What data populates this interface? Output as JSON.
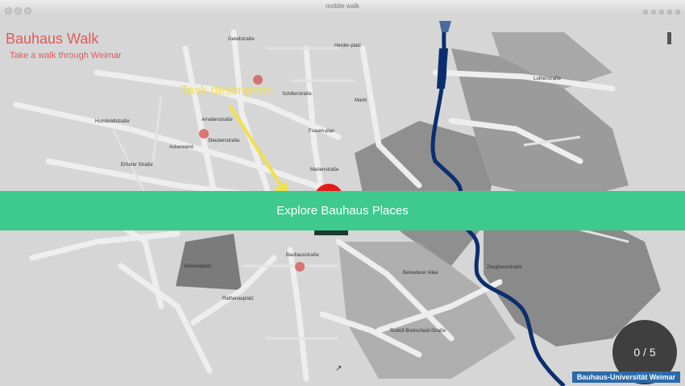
{
  "window": {
    "title": "mobile walk"
  },
  "app": {
    "title": "Bauhaus Walk",
    "subtitle": "Take a walk through Weimar"
  },
  "annotation": {
    "label": "Task description"
  },
  "task": {
    "banner_text": "Explore Bauhaus Places"
  },
  "progress": {
    "text": "0 / 5"
  },
  "footer": {
    "logo_text": "Bauhaus-Universität Weimar"
  },
  "map": {
    "street_labels": [
      "Herder-platz",
      "Lutherstraße",
      "Schillerstraße",
      "Markt",
      "Frauen-plan",
      "Steubenstraße",
      "Erfurter Straße",
      "Geleitstraße",
      "Marienstraße",
      "Bauhausstraße",
      "Belvederer Allee",
      "Rudolf-Breitscheid-Straße",
      "Wielandplatz",
      "Ackerwand",
      "Humboldtstraße",
      "Amalienstraße",
      "Rathenauplatz",
      "Zeughausstraße"
    ]
  },
  "colors": {
    "accent": "#3ec98f",
    "title": "#e25a5a",
    "annotation": "#f1e14a",
    "river": "#0b2e6e",
    "marker": "#d45a55",
    "active_marker": "#e31b1b"
  }
}
